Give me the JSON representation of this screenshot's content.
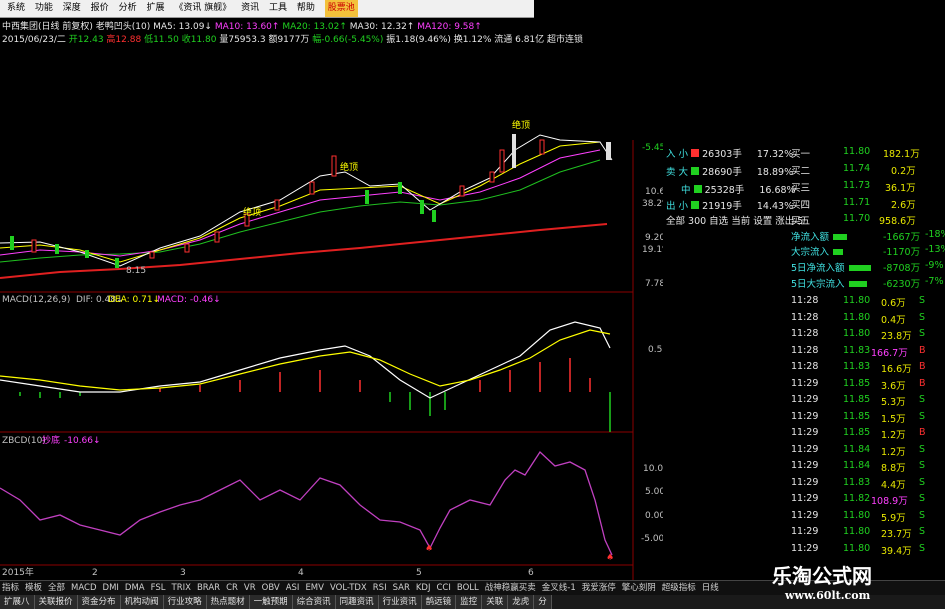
{
  "menu": [
    "系统",
    "功能",
    "深度",
    "报价",
    "分析",
    "扩展",
    "《资讯 旗舰》",
    "资讯",
    "工具",
    "帮助",
    "股票池"
  ],
  "stock": {
    "title": "中西集团(日线 前复权)",
    "indicator": "老鸭凹头(10)",
    "ma5": "MA5: 13.09↓",
    "ma10": "MA10: 13.60↑",
    "ma20": "MA20: 13.02↑",
    "ma30": "MA30: 12.32↑",
    "ma120": "MA120: 9.58↑",
    "date": "2015/06/23/二",
    "open": "开12.43",
    "high": "高12.88",
    "low": "低11.50",
    "close": "收11.80",
    "volume": "量75953.3",
    "amount": "额9177万",
    "change": "幅-0.66(-5.45%)",
    "turnover": "振1.18(9.46%)",
    "swap": "换1.12%",
    "float": "流通 6.81亿",
    "signal": "超市连锁"
  },
  "price_axis": [
    "-5.45%",
    "10.61",
    "38.2%",
    "9.20",
    "19.1%",
    "7.78"
  ],
  "macd": {
    "label": "MACD(12,26,9)",
    "dif": "DIF: 0.48↓",
    "dea": "DEA: 0.71↓",
    "macd": "MACD: -0.46↓",
    "tick": "0.50"
  },
  "zbcd": {
    "label": "ZBCD(10)",
    "name": "抄底",
    "value": "-10.66↓",
    "ticks": [
      "10.00",
      "5.00",
      "0.00",
      "-5.00"
    ]
  },
  "chart_annotations": {
    "top1": "绝顶",
    "top2": "绝顶",
    "top3": "绝顶",
    "low": "8.15"
  },
  "x_axis": [
    "2015年",
    "2",
    "3",
    "4",
    "5",
    "6"
  ],
  "flow": {
    "rows": [
      {
        "dir": "入",
        "size": "小",
        "vol": "26303手",
        "pct": "17.32%"
      },
      {
        "dir": "卖",
        "size": "大",
        "vol": "28690手",
        "pct": "18.89%"
      },
      {
        "dir": "",
        "size": "中",
        "vol": "25328手",
        "pct": "16.68%"
      },
      {
        "dir": "出",
        "size": "小",
        "vol": "21919手",
        "pct": "14.43%"
      }
    ],
    "footer": "全部 300 自选 当前 设置 涨出 5"
  },
  "orderbook": [
    {
      "label": "买一",
      "price": "11.80",
      "vol": "182.1万"
    },
    {
      "label": "买二",
      "price": "11.74",
      "vol": "0.2万"
    },
    {
      "label": "买三",
      "price": "11.73",
      "vol": "36.1万"
    },
    {
      "label": "买四",
      "price": "11.71",
      "vol": "2.6万"
    },
    {
      "label": "买五",
      "price": "11.70",
      "vol": "958.6万"
    }
  ],
  "netflow": [
    {
      "label": "净流入额",
      "value": "-1667万",
      "pct": "-18%"
    },
    {
      "label": "大宗流入",
      "value": "-1170万",
      "pct": "-13%"
    },
    {
      "label": "5日净流入额",
      "value": "-8708万",
      "pct": "-9%"
    },
    {
      "label": "5日大宗流入",
      "value": "-6230万",
      "pct": "-7%"
    }
  ],
  "ticks": [
    {
      "t": "11:28",
      "p": "11.80",
      "v": "0.6万",
      "s": "S",
      "pc": "#20d020"
    },
    {
      "t": "11:28",
      "p": "11.80",
      "v": "0.4万",
      "s": "S",
      "pc": "#20d020"
    },
    {
      "t": "11:28",
      "p": "11.80",
      "v": "23.8万",
      "s": "S",
      "pc": "#20d020"
    },
    {
      "t": "11:28",
      "p": "11.83",
      "v": "166.7万",
      "s": "B",
      "pc": "#20d020",
      "vc": "#ff40ff"
    },
    {
      "t": "11:28",
      "p": "11.83",
      "v": "16.6万",
      "s": "B",
      "pc": "#20d020"
    },
    {
      "t": "11:29",
      "p": "11.85",
      "v": "3.6万",
      "s": "B",
      "pc": "#20d020"
    },
    {
      "t": "11:29",
      "p": "11.85",
      "v": "5.3万",
      "s": "S",
      "pc": "#20d020"
    },
    {
      "t": "11:29",
      "p": "11.85",
      "v": "1.5万",
      "s": "S",
      "pc": "#20d020"
    },
    {
      "t": "11:29",
      "p": "11.85",
      "v": "1.2万",
      "s": "B",
      "pc": "#20d020"
    },
    {
      "t": "11:29",
      "p": "11.84",
      "v": "1.2万",
      "s": "S",
      "pc": "#20d020"
    },
    {
      "t": "11:29",
      "p": "11.84",
      "v": "8.8万",
      "s": "S",
      "pc": "#20d020"
    },
    {
      "t": "11:29",
      "p": "11.83",
      "v": "4.4万",
      "s": "S",
      "pc": "#20d020"
    },
    {
      "t": "11:29",
      "p": "11.82",
      "v": "108.9万",
      "s": "S",
      "pc": "#20d020",
      "vc": "#ff40ff"
    },
    {
      "t": "11:29",
      "p": "11.80",
      "v": "5.9万",
      "s": "S",
      "pc": "#20d020"
    },
    {
      "t": "11:29",
      "p": "11.80",
      "v": "23.7万",
      "s": "S",
      "pc": "#20d020"
    },
    {
      "t": "11:29",
      "p": "11.80",
      "v": "39.4万",
      "s": "S",
      "pc": "#20d020"
    }
  ],
  "indicator_bar": [
    "指标",
    "模板",
    "全部",
    "MACD",
    "DMI",
    "DMA",
    "FSL",
    "TRIX",
    "BRAR",
    "CR",
    "VR",
    "OBV",
    "ASI",
    "EMV",
    "VOL-TDX",
    "RSI",
    "SAR",
    "KDJ",
    "CCI",
    "BOLL",
    "战神稳赢买卖",
    "金叉线-1",
    "我爱涨停",
    "擎心刻阴",
    "超级指标",
    "日线"
  ],
  "tabs": [
    "扩展八",
    "关联报价",
    "资金分布",
    "机构动阀",
    "行业攻略",
    "热点题材",
    "一触预期",
    "综合资讯",
    "同趣资讯",
    "行业资讯",
    "鹊远镜",
    "监控",
    "关联",
    "龙虎",
    "分"
  ],
  "watermark": {
    "main": "乐淘公式网",
    "url": "www.60lt.com"
  },
  "colors": {
    "up": "#ff3030",
    "down": "#20d020",
    "ma5": "#ffffff",
    "ma10": "#ffff00",
    "ma20": "#ff40ff",
    "ma30": "#20d020",
    "ma120": "#ff2020"
  }
}
